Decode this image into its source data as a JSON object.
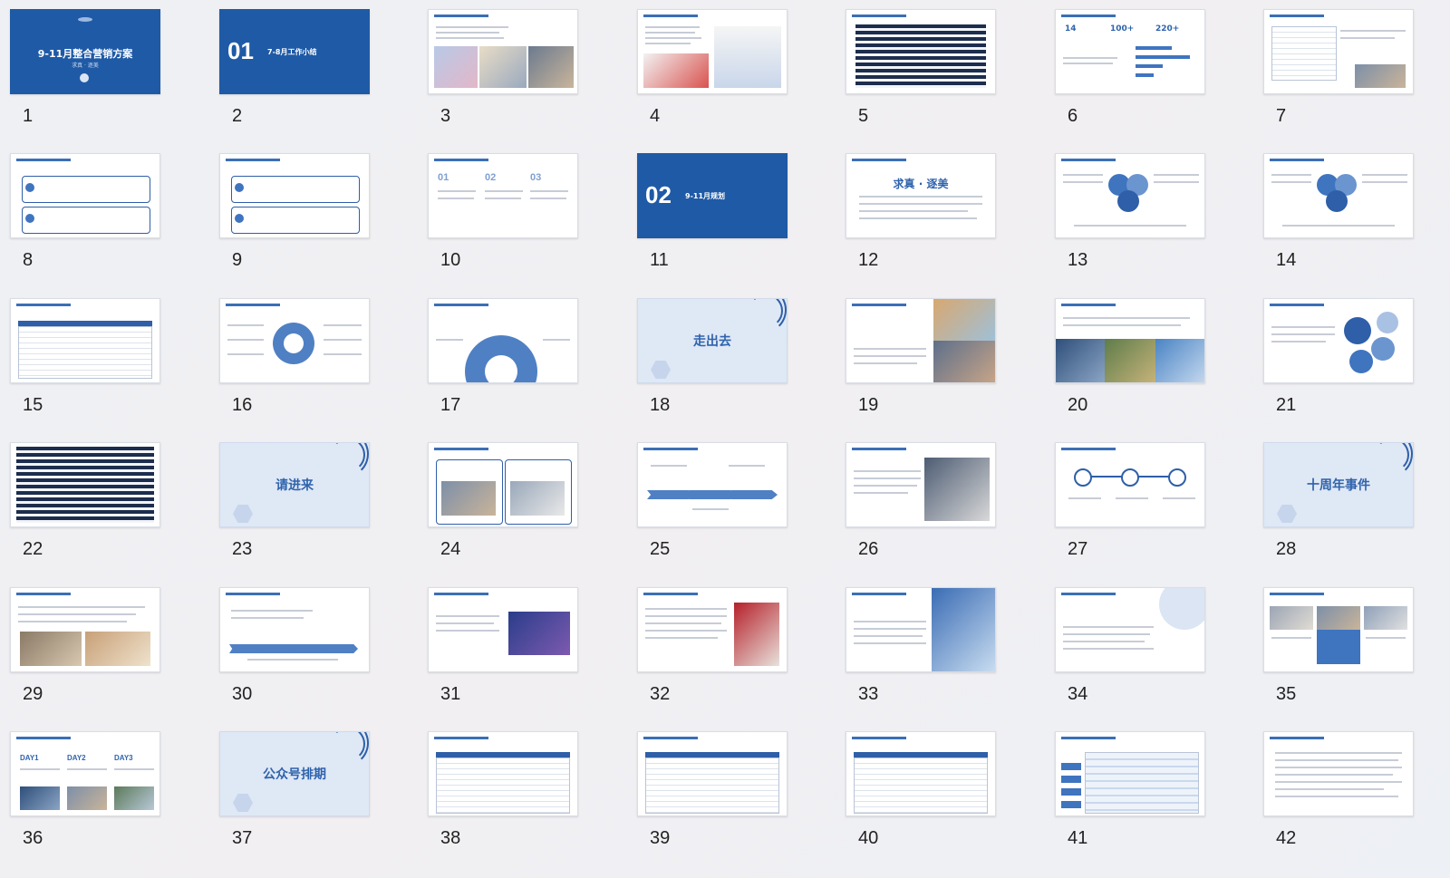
{
  "slides": [
    {
      "number": "1",
      "title": "9-11月整合营销方案",
      "subtitle": "求真 · 逐美"
    },
    {
      "number": "2",
      "section": "01",
      "section_title": "7-8月工作小结"
    },
    {
      "number": "3"
    },
    {
      "number": "4"
    },
    {
      "number": "5"
    },
    {
      "number": "6",
      "stats": [
        "14",
        "100+",
        "220+"
      ]
    },
    {
      "number": "7"
    },
    {
      "number": "8"
    },
    {
      "number": "9"
    },
    {
      "number": "10",
      "columns": [
        "01",
        "02",
        "03"
      ]
    },
    {
      "number": "11",
      "section": "02",
      "section_title": "9-11月规划"
    },
    {
      "number": "12",
      "title": "求真 · 逐美"
    },
    {
      "number": "13"
    },
    {
      "number": "14"
    },
    {
      "number": "15"
    },
    {
      "number": "16"
    },
    {
      "number": "17"
    },
    {
      "number": "18",
      "title": "走出去"
    },
    {
      "number": "19"
    },
    {
      "number": "20"
    },
    {
      "number": "21"
    },
    {
      "number": "22"
    },
    {
      "number": "23",
      "title": "请进来"
    },
    {
      "number": "24"
    },
    {
      "number": "25"
    },
    {
      "number": "26"
    },
    {
      "number": "27"
    },
    {
      "number": "28",
      "title": "十周年事件"
    },
    {
      "number": "29"
    },
    {
      "number": "30"
    },
    {
      "number": "31"
    },
    {
      "number": "32"
    },
    {
      "number": "33"
    },
    {
      "number": "34"
    },
    {
      "number": "35"
    },
    {
      "number": "36",
      "days": [
        "DAY1",
        "DAY2",
        "DAY3"
      ]
    },
    {
      "number": "37",
      "title": "公众号排期"
    },
    {
      "number": "38"
    },
    {
      "number": "39"
    },
    {
      "number": "40"
    },
    {
      "number": "41"
    },
    {
      "number": "42"
    }
  ]
}
